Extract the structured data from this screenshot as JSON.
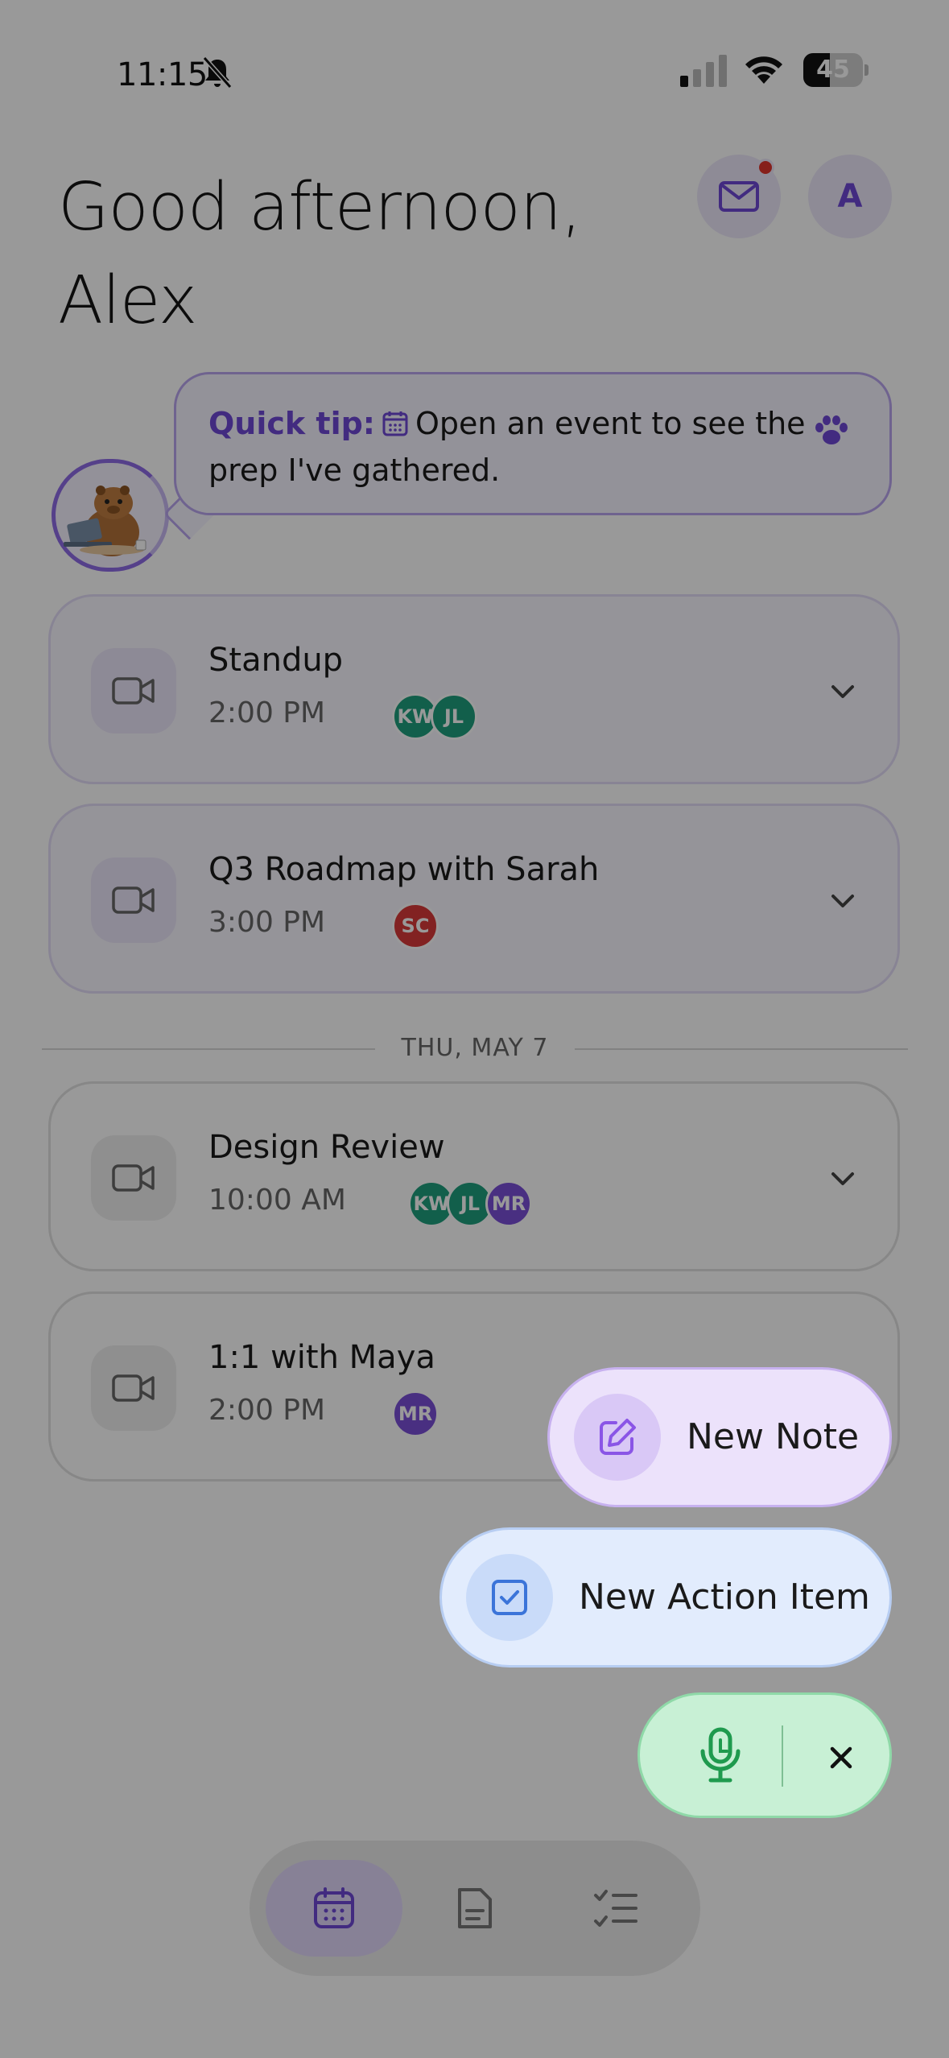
{
  "status": {
    "time": "11:15",
    "battery": "45",
    "battery_level": 0.45
  },
  "header": {
    "greeting_line1": "Good afternoon,",
    "greeting_line2": "Alex",
    "avatar_initial": "A"
  },
  "tip": {
    "label": "Quick tip:",
    "text": "Open an event to see the prep I've gathered."
  },
  "events": [
    {
      "title": "Standup",
      "time": "2:00 PM",
      "attendees": [
        {
          "initials": "KW",
          "color": "#1f9f7e"
        },
        {
          "initials": "JL",
          "color": "#1f9f7e"
        }
      ]
    },
    {
      "title": "Q3 Roadmap with Sarah",
      "time": "3:00 PM",
      "attendees": [
        {
          "initials": "SC",
          "color": "#d9393a"
        }
      ]
    },
    {
      "title": "Design Review",
      "time": "10:00 AM",
      "attendees": [
        {
          "initials": "KW",
          "color": "#1f9f7e"
        },
        {
          "initials": "JL",
          "color": "#1f9f7e"
        },
        {
          "initials": "MR",
          "color": "#7a4fd8"
        }
      ]
    },
    {
      "title": "1:1 with Maya",
      "time": "2:00 PM",
      "attendees": [
        {
          "initials": "MR",
          "color": "#7a4fd8"
        }
      ]
    }
  ],
  "day_divider": "THU, MAY 7",
  "fab_menu": {
    "new_note": "New Note",
    "new_action_item": "New Action Item"
  },
  "colors": {
    "accent": "#6e49d6",
    "note_bg": "#ece2fb",
    "action_bg": "#e2ecfd",
    "mic_bg": "#c8f0d5",
    "notification": "#e0342c"
  },
  "icons": {
    "mail": "mail-icon",
    "camera": "video-camera-icon",
    "chevron": "chevron-down-icon",
    "note": "pencil-square-icon",
    "action": "checkbox-icon",
    "mic": "microphone-icon",
    "close": "close-icon",
    "nav": [
      "calendar-icon",
      "document-icon",
      "checklist-icon"
    ]
  }
}
